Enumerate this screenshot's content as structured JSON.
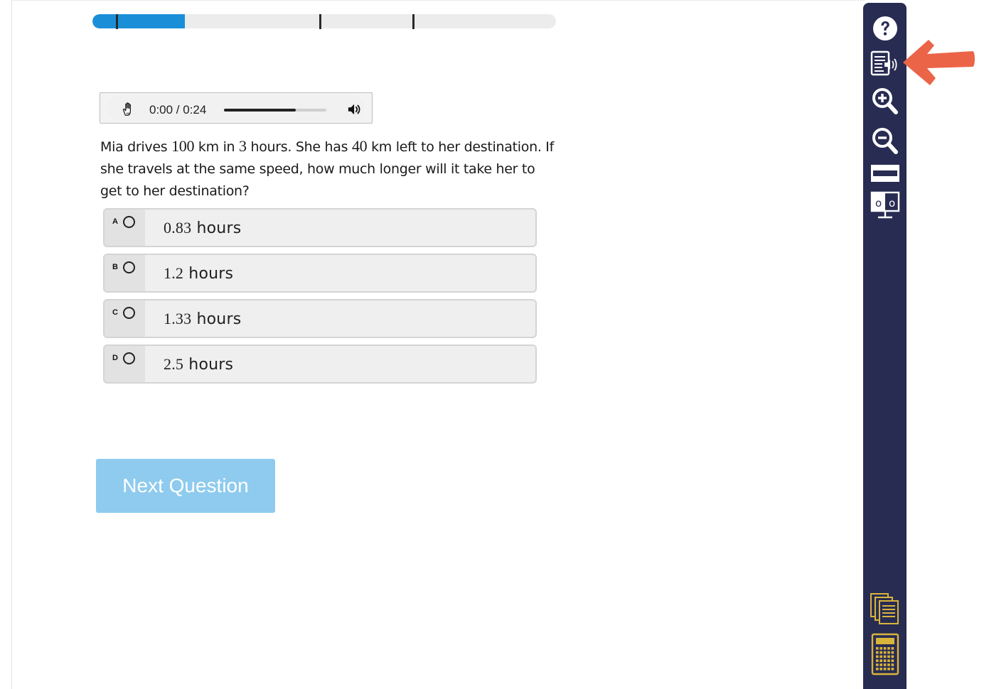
{
  "progress": {
    "fraction": 0.2,
    "tick_count": 3
  },
  "audio": {
    "time": "0:00 / 0:24",
    "volume_fraction": 0.7,
    "hand_icon": "hand-pointer-icon",
    "volume_icon": "volume-icon"
  },
  "question": {
    "parts": [
      "Mia drives ",
      "100",
      " km in ",
      "3",
      " hours. She has ",
      "40",
      " km left to her destination. If she travels at the same speed, how much longer will it take her to get to her destination?"
    ]
  },
  "choices": [
    {
      "letter": "A",
      "value": "0.83",
      "unit": " hours"
    },
    {
      "letter": "B",
      "value": "1.2",
      "unit": " hours"
    },
    {
      "letter": "C",
      "value": "1.33",
      "unit": " hours"
    },
    {
      "letter": "D",
      "value": "2.5",
      "unit": " hours"
    }
  ],
  "next_button": {
    "label": "Next Question"
  },
  "toolbar": {
    "items": [
      "help-icon",
      "text-to-speech-icon",
      "zoom-in-icon",
      "zoom-out-icon",
      "line-reader-icon",
      "contrast-monitor-icon",
      "reference-sheets-icon",
      "calculator-icon"
    ],
    "colors": {
      "background": "#282c52",
      "icon": "#ffffff",
      "accent": "#d9b43a"
    }
  },
  "colors": {
    "progress_fill": "#1a8fd8",
    "next_button": "#8ecbee",
    "annotation_arrow": "#ec6448"
  }
}
